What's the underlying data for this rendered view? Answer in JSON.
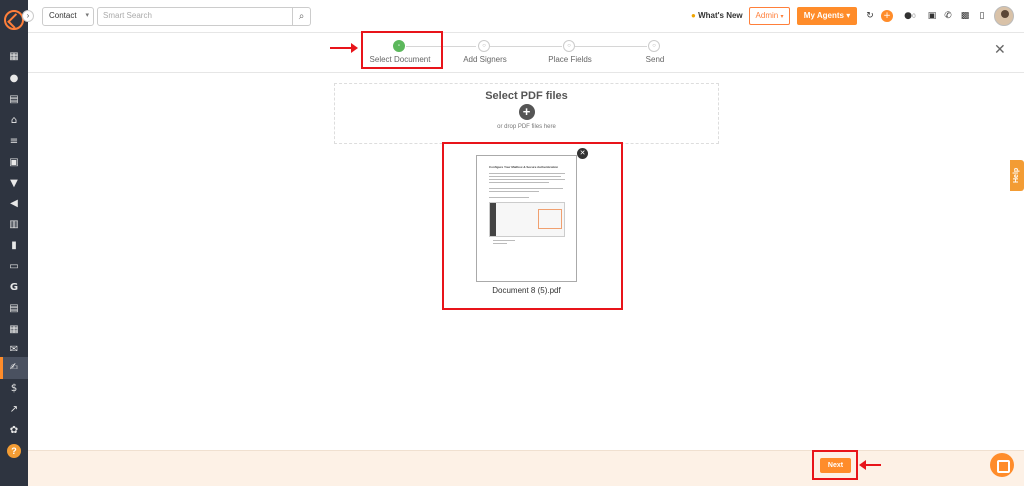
{
  "topbar": {
    "contact_select": "Contact",
    "search_placeholder": "Smart Search",
    "whats_new": "What's New",
    "admin_label": "Admin",
    "agents_label": "My Agents",
    "badge_count": "0"
  },
  "stepper": {
    "steps": [
      {
        "label": "Select Document",
        "active": true
      },
      {
        "label": "Add Signers",
        "active": false
      },
      {
        "label": "Place Fields",
        "active": false
      },
      {
        "label": "Send",
        "active": false
      }
    ]
  },
  "dropzone": {
    "title": "Select PDF files",
    "hint": "or drop PDF files here"
  },
  "document": {
    "filename": "Document 8 (5).pdf",
    "thumb_title": "Configure Your Mailbox & Secure Authentication"
  },
  "footer": {
    "next_label": "Next"
  },
  "help_tab": "Help",
  "colors": {
    "accent": "#ff8c2a",
    "sidebar": "#2e3440",
    "step_active": "#5cb85c",
    "annotation": "#e8141a",
    "footer_bg": "#fdf1e6"
  }
}
